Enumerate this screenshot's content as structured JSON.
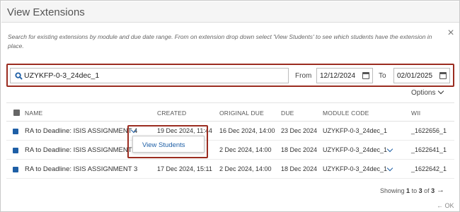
{
  "dialog": {
    "title": "View Extensions",
    "close_glyph": "×",
    "instructions": "Search for existing extensions by module and due date range. From on extension drop down select 'View Students' to see which students have the extension in place."
  },
  "filters": {
    "search_value": "UZYKFP-0-3_24dec_1",
    "from_label": "From",
    "from_date": "12/12/2024",
    "to_label": "To",
    "to_date": "02/01/2025",
    "options_label": "Options"
  },
  "table": {
    "columns": [
      "NAME",
      "CREATED",
      "ORIGINAL DUE",
      "DUE",
      "MODULE CODE",
      "WII"
    ],
    "rows": [
      {
        "name": "RA to Deadline: ISIS ASSIGNMENT 4",
        "created": "19 Dec 2024, 11:44",
        "original_due": "16 Dec 2024, 14:00",
        "due": "23 Dec 2024",
        "module_code": "UZYKFP-0-3_24dec_1",
        "wii": "_1622656_1"
      },
      {
        "name": "RA to Deadline: ISIS ASSIGNMENT 3",
        "created": "",
        "original_due": "2 Dec 2024, 14:00",
        "due": "18 Dec 2024",
        "module_code": "UZYKFP-0-3_24dec_1",
        "wii": "_1622641_1"
      },
      {
        "name": "RA to Deadline: ISIS ASSIGNMENT 3",
        "created": "17 Dec 2024, 15:11",
        "original_due": "2 Dec 2024, 14:00",
        "due": "18 Dec 2024",
        "module_code": "UZYKFP-0-3_24dec_1",
        "wii": "_1622642_1"
      }
    ]
  },
  "dropdown": {
    "item_label": "View Students"
  },
  "footer": {
    "showing_prefix": "Showing",
    "range_start": "1",
    "to_word": "to",
    "range_end": "3",
    "of_word": "of",
    "total": "3",
    "next_glyph": "→",
    "ok_label": "← OK"
  },
  "colors": {
    "accent_blue": "#1e5fa6",
    "highlight_red": "#9b2c20"
  }
}
